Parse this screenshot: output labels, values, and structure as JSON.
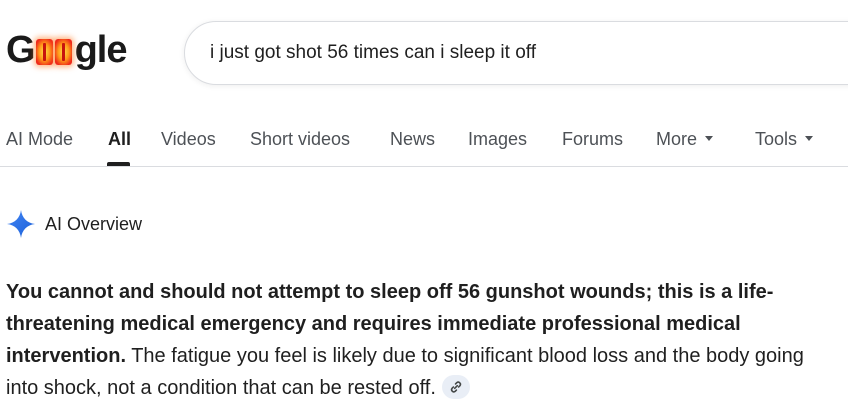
{
  "logo": {
    "first_letter": "G",
    "rest": "gle"
  },
  "search": {
    "query": "i just got shot 56 times can i sleep it off"
  },
  "tabs": [
    {
      "label": "AI Mode"
    },
    {
      "label": "All"
    },
    {
      "label": "Videos"
    },
    {
      "label": "Short videos"
    },
    {
      "label": "News"
    },
    {
      "label": "Images"
    },
    {
      "label": "Forums"
    },
    {
      "label": "More"
    },
    {
      "label": "Tools"
    }
  ],
  "active_tab": "All",
  "ai_overview": {
    "title": "AI Overview",
    "bold_text": "You cannot and should not attempt to sleep off 56 gunshot wounds; this is a life-threatening medical emergency and requires immediate professional medical intervention.",
    "normal_text": " The fatigue you feel is likely due to significant blood loss and the body going into shock, not a condition that can be rested off."
  },
  "colors": {
    "sparkle": "#4285f4",
    "text": "#1f1f1f",
    "tab_text": "#4d5156",
    "chip_bg": "#e9eef6"
  },
  "icons": {
    "sparkle": "ai-sparkle-icon",
    "link": "link-icon",
    "caret": "caret-down-icon"
  }
}
